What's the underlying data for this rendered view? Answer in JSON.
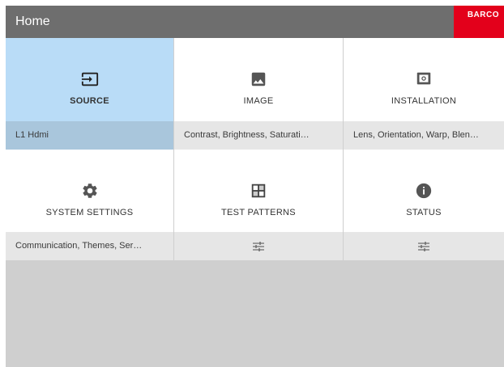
{
  "header": {
    "title": "Home",
    "logo_text": "BARCO",
    "brand_color": "#e3001b"
  },
  "tiles": [
    {
      "label": "SOURCE",
      "icon": "input-icon",
      "subtitle": "L1 Hdmi"
    },
    {
      "label": "IMAGE",
      "icon": "image-icon",
      "subtitle": "Contrast, Brightness, Saturati…"
    },
    {
      "label": "INSTALLATION",
      "icon": "installation-icon",
      "subtitle": "Lens, Orientation, Warp, Blen…"
    },
    {
      "label": "SYSTEM SETTINGS",
      "icon": "gear-icon",
      "subtitle": "Communication, Themes, Ser…"
    },
    {
      "label": "TEST PATTERNS",
      "icon": "test-pattern-icon",
      "subtitle": ""
    },
    {
      "label": "STATUS",
      "icon": "info-icon",
      "subtitle": ""
    }
  ],
  "selected_tile": "SOURCE",
  "colors": {
    "selected_tile": "#b9dcf7",
    "selected_subtitle": "#a9c6dc",
    "header": "#6e6e6e"
  }
}
